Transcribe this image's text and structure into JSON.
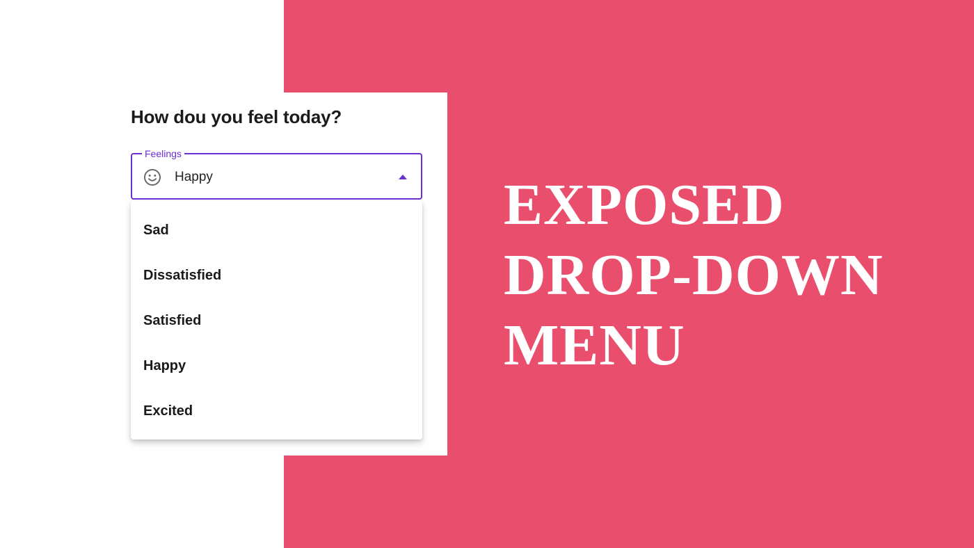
{
  "colors": {
    "accent": "#6b2fd6",
    "panel_background": "#ea4e6d",
    "card_background": "#ffffff",
    "headline_text": "#ffffff"
  },
  "form": {
    "question": "How dou you feel today?",
    "field": {
      "label": "Feelings",
      "leading_icon": "smiley-face-icon",
      "value": "Happy",
      "trailing_icon": "caret-up-icon",
      "expanded": true
    }
  },
  "menu": {
    "items": [
      {
        "label": "Sad"
      },
      {
        "label": "Dissatisfied"
      },
      {
        "label": "Satisfied"
      },
      {
        "label": "Happy"
      },
      {
        "label": "Excited"
      }
    ]
  },
  "headline": {
    "lines": [
      "EXPOSED",
      "DROP-DOWN",
      "MENU"
    ]
  }
}
